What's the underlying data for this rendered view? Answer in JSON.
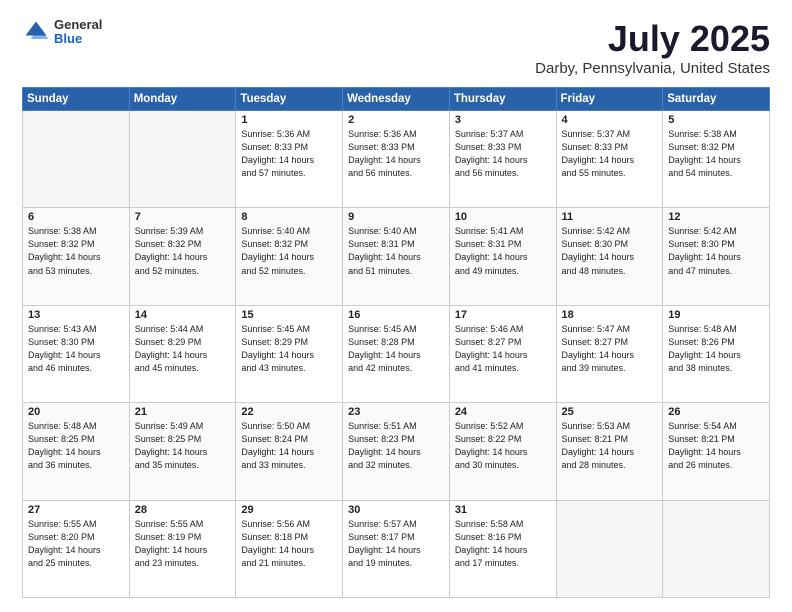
{
  "header": {
    "logo_general": "General",
    "logo_blue": "Blue",
    "title": "July 2025",
    "subtitle": "Darby, Pennsylvania, United States"
  },
  "days_of_week": [
    "Sunday",
    "Monday",
    "Tuesday",
    "Wednesday",
    "Thursday",
    "Friday",
    "Saturday"
  ],
  "weeks": [
    [
      {
        "day": "",
        "info": ""
      },
      {
        "day": "",
        "info": ""
      },
      {
        "day": "1",
        "info": "Sunrise: 5:36 AM\nSunset: 8:33 PM\nDaylight: 14 hours\nand 57 minutes."
      },
      {
        "day": "2",
        "info": "Sunrise: 5:36 AM\nSunset: 8:33 PM\nDaylight: 14 hours\nand 56 minutes."
      },
      {
        "day": "3",
        "info": "Sunrise: 5:37 AM\nSunset: 8:33 PM\nDaylight: 14 hours\nand 56 minutes."
      },
      {
        "day": "4",
        "info": "Sunrise: 5:37 AM\nSunset: 8:33 PM\nDaylight: 14 hours\nand 55 minutes."
      },
      {
        "day": "5",
        "info": "Sunrise: 5:38 AM\nSunset: 8:32 PM\nDaylight: 14 hours\nand 54 minutes."
      }
    ],
    [
      {
        "day": "6",
        "info": "Sunrise: 5:38 AM\nSunset: 8:32 PM\nDaylight: 14 hours\nand 53 minutes."
      },
      {
        "day": "7",
        "info": "Sunrise: 5:39 AM\nSunset: 8:32 PM\nDaylight: 14 hours\nand 52 minutes."
      },
      {
        "day": "8",
        "info": "Sunrise: 5:40 AM\nSunset: 8:32 PM\nDaylight: 14 hours\nand 52 minutes."
      },
      {
        "day": "9",
        "info": "Sunrise: 5:40 AM\nSunset: 8:31 PM\nDaylight: 14 hours\nand 51 minutes."
      },
      {
        "day": "10",
        "info": "Sunrise: 5:41 AM\nSunset: 8:31 PM\nDaylight: 14 hours\nand 49 minutes."
      },
      {
        "day": "11",
        "info": "Sunrise: 5:42 AM\nSunset: 8:30 PM\nDaylight: 14 hours\nand 48 minutes."
      },
      {
        "day": "12",
        "info": "Sunrise: 5:42 AM\nSunset: 8:30 PM\nDaylight: 14 hours\nand 47 minutes."
      }
    ],
    [
      {
        "day": "13",
        "info": "Sunrise: 5:43 AM\nSunset: 8:30 PM\nDaylight: 14 hours\nand 46 minutes."
      },
      {
        "day": "14",
        "info": "Sunrise: 5:44 AM\nSunset: 8:29 PM\nDaylight: 14 hours\nand 45 minutes."
      },
      {
        "day": "15",
        "info": "Sunrise: 5:45 AM\nSunset: 8:29 PM\nDaylight: 14 hours\nand 43 minutes."
      },
      {
        "day": "16",
        "info": "Sunrise: 5:45 AM\nSunset: 8:28 PM\nDaylight: 14 hours\nand 42 minutes."
      },
      {
        "day": "17",
        "info": "Sunrise: 5:46 AM\nSunset: 8:27 PM\nDaylight: 14 hours\nand 41 minutes."
      },
      {
        "day": "18",
        "info": "Sunrise: 5:47 AM\nSunset: 8:27 PM\nDaylight: 14 hours\nand 39 minutes."
      },
      {
        "day": "19",
        "info": "Sunrise: 5:48 AM\nSunset: 8:26 PM\nDaylight: 14 hours\nand 38 minutes."
      }
    ],
    [
      {
        "day": "20",
        "info": "Sunrise: 5:48 AM\nSunset: 8:25 PM\nDaylight: 14 hours\nand 36 minutes."
      },
      {
        "day": "21",
        "info": "Sunrise: 5:49 AM\nSunset: 8:25 PM\nDaylight: 14 hours\nand 35 minutes."
      },
      {
        "day": "22",
        "info": "Sunrise: 5:50 AM\nSunset: 8:24 PM\nDaylight: 14 hours\nand 33 minutes."
      },
      {
        "day": "23",
        "info": "Sunrise: 5:51 AM\nSunset: 8:23 PM\nDaylight: 14 hours\nand 32 minutes."
      },
      {
        "day": "24",
        "info": "Sunrise: 5:52 AM\nSunset: 8:22 PM\nDaylight: 14 hours\nand 30 minutes."
      },
      {
        "day": "25",
        "info": "Sunrise: 5:53 AM\nSunset: 8:21 PM\nDaylight: 14 hours\nand 28 minutes."
      },
      {
        "day": "26",
        "info": "Sunrise: 5:54 AM\nSunset: 8:21 PM\nDaylight: 14 hours\nand 26 minutes."
      }
    ],
    [
      {
        "day": "27",
        "info": "Sunrise: 5:55 AM\nSunset: 8:20 PM\nDaylight: 14 hours\nand 25 minutes."
      },
      {
        "day": "28",
        "info": "Sunrise: 5:55 AM\nSunset: 8:19 PM\nDaylight: 14 hours\nand 23 minutes."
      },
      {
        "day": "29",
        "info": "Sunrise: 5:56 AM\nSunset: 8:18 PM\nDaylight: 14 hours\nand 21 minutes."
      },
      {
        "day": "30",
        "info": "Sunrise: 5:57 AM\nSunset: 8:17 PM\nDaylight: 14 hours\nand 19 minutes."
      },
      {
        "day": "31",
        "info": "Sunrise: 5:58 AM\nSunset: 8:16 PM\nDaylight: 14 hours\nand 17 minutes."
      },
      {
        "day": "",
        "info": ""
      },
      {
        "day": "",
        "info": ""
      }
    ]
  ]
}
